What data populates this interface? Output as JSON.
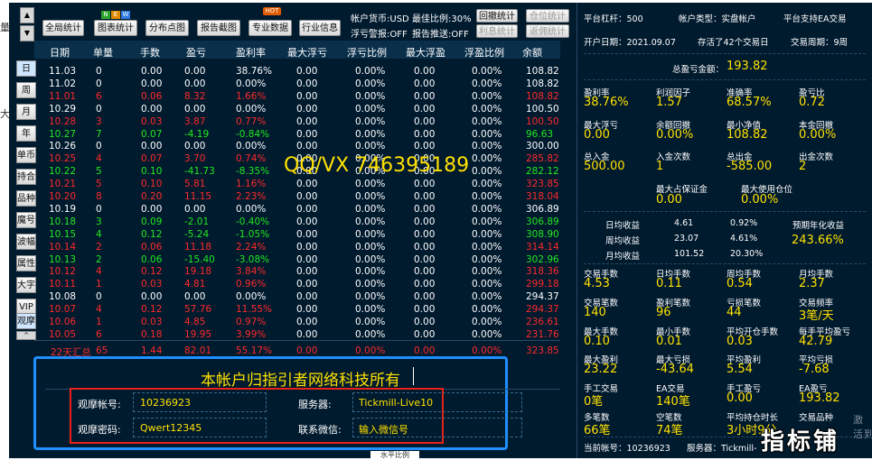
{
  "toolbar": {
    "buttons": [
      "全局统计",
      "图表统计",
      "分布点图",
      "报告截图",
      "专业数据",
      "行业信息"
    ],
    "hot_badge": "HOT",
    "mini_badges": [
      "N",
      "E",
      "W"
    ],
    "info": {
      "currency": "帐户货币:USD",
      "max_ratio": "最佳比例:30%",
      "stop_warning": "浮亏警报:OFF",
      "report_push": "报告推送:OFF"
    },
    "right_buttons": [
      "回撤统计",
      "仓位统计",
      "利息统计",
      "返佣统计"
    ]
  },
  "side_nav": [
    "日",
    "周",
    "月",
    "年",
    "单币",
    "持合",
    "品种",
    "魔号",
    "波幅",
    "属性",
    "大字",
    "VIP",
    "观摩"
  ],
  "table": {
    "headers": [
      "日期",
      "单量",
      "手数",
      "盈亏",
      "盈利率",
      "最大浮亏",
      "浮亏比例",
      "最大浮盈",
      "浮盈比例",
      "余额"
    ],
    "rows": [
      [
        "11.03",
        "0",
        "0.00",
        "0.00",
        "38.76%",
        "0.00",
        "0.00%",
        "0.00",
        "0.00%",
        "108.82",
        "w"
      ],
      [
        "11.02",
        "0",
        "0.00",
        "0.00",
        "0.00%",
        "0.00",
        "0.00%",
        "0.00",
        "0.00%",
        "108.82",
        "w"
      ],
      [
        "11.01",
        "6",
        "0.06",
        "8.32",
        "1.66%",
        "0.00",
        "0.00%",
        "0.00",
        "0.00%",
        "108.82",
        "r"
      ],
      [
        "10.29",
        "0",
        "0.00",
        "0.00",
        "0.00%",
        "0.00",
        "0.00%",
        "0.00",
        "0.00%",
        "100.50",
        "w"
      ],
      [
        "10.28",
        "3",
        "0.03",
        "3.87",
        "0.77%",
        "0.00",
        "0.00%",
        "0.00",
        "0.00%",
        "100.50",
        "r"
      ],
      [
        "10.27",
        "7",
        "0.07",
        "-4.19",
        "-0.84%",
        "0.00",
        "0.00%",
        "0.00",
        "0.00%",
        "96.63",
        "g"
      ],
      [
        "10.26",
        "0",
        "0.00",
        "0.00",
        "0.00%",
        "0.00",
        "0.00%",
        "0.00",
        "0.00%",
        "300.00",
        "w"
      ],
      [
        "10.25",
        "4",
        "0.07",
        "3.70",
        "0.74%",
        "0.00",
        "0.00%",
        "0.00",
        "0.00%",
        "285.82",
        "r"
      ],
      [
        "10.22",
        "5",
        "0.10",
        "-41.73",
        "-8.35%",
        "0.00",
        "0.00%",
        "0.00",
        "0.00%",
        "282.12",
        "g"
      ],
      [
        "10.21",
        "5",
        "0.10",
        "5.81",
        "1.16%",
        "0.00",
        "0.00%",
        "0.00",
        "0.00%",
        "323.85",
        "r"
      ],
      [
        "10.20",
        "8",
        "0.20",
        "11.15",
        "2.23%",
        "0.00",
        "0.00%",
        "0.00",
        "0.00%",
        "318.04",
        "r"
      ],
      [
        "10.19",
        "0",
        "0.00",
        "0.00",
        "0.00%",
        "0.00",
        "0.00%",
        "0.00",
        "0.00%",
        "306.89",
        "w"
      ],
      [
        "10.18",
        "3",
        "0.09",
        "-2.01",
        "-0.40%",
        "0.00",
        "0.00%",
        "0.00",
        "0.00%",
        "306.89",
        "g"
      ],
      [
        "10.15",
        "4",
        "0.12",
        "-5.24",
        "-1.05%",
        "0.00",
        "0.00%",
        "0.00",
        "0.00%",
        "308.90",
        "g"
      ],
      [
        "10.14",
        "2",
        "0.06",
        "11.18",
        "2.24%",
        "0.00",
        "0.00%",
        "0.00",
        "0.00%",
        "314.14",
        "r"
      ],
      [
        "10.13",
        "2",
        "0.06",
        "-15.40",
        "-3.08%",
        "0.00",
        "0.00%",
        "0.00",
        "0.00%",
        "302.96",
        "g"
      ],
      [
        "10.12",
        "4",
        "0.12",
        "19.18",
        "3.84%",
        "0.00",
        "0.00%",
        "0.00",
        "0.00%",
        "318.36",
        "r"
      ],
      [
        "10.11",
        "1",
        "0.03",
        "4.81",
        "0.96%",
        "0.00",
        "0.00%",
        "0.00",
        "0.00%",
        "299.18",
        "r"
      ],
      [
        "10.08",
        "0",
        "0.00",
        "0.00",
        "0.00%",
        "0.00",
        "0.00%",
        "0.00",
        "0.00%",
        "294.37",
        "w"
      ],
      [
        "10.07",
        "4",
        "0.12",
        "57.76",
        "11.55%",
        "0.00",
        "0.00%",
        "0.00",
        "0.00%",
        "294.37",
        "r"
      ],
      [
        "10.06",
        "1",
        "0.03",
        "4.85",
        "0.97%",
        "0.00",
        "0.00%",
        "0.00",
        "0.00%",
        "236.61",
        "r"
      ],
      [
        "10.05",
        "6",
        "0.18",
        "19.95",
        "3.99%",
        "0.00",
        "0.00%",
        "0.00",
        "0.00%",
        "231.76",
        "r"
      ]
    ],
    "total_row": [
      "22天汇总",
      "65",
      "1.44",
      "82.01",
      "55.17%",
      "0.00",
      "0.00%",
      "0.00",
      "0.00%",
      "323.85"
    ]
  },
  "watermark": "QQ/VX 746395189",
  "ownership": {
    "title": "本帐户归指引者网络科技所有",
    "account_label": "观摩帐号:",
    "account_value": "10236923",
    "server_label": "服务器:",
    "server_value": "Tickmill-Live10",
    "password_label": "观摩密码:",
    "password_value": "Qwert12345",
    "wechat_label": "联系微信:",
    "wechat_value": "输入微信号"
  },
  "bottom_tab": "水平比例",
  "right_panel": {
    "top": {
      "leverage": "平台杠杆：500",
      "account_type": "帐户类型：实盘帐户",
      "ea_support": "平台支持EA交易",
      "open_date": "开户日期：2021.09.07",
      "survived": "存活了42个交易日",
      "cycle": "交易周期：9周"
    },
    "total_profit_label": "总盈亏金额：",
    "total_profit_value": "193.82",
    "grid1": [
      {
        "label": "盈利率",
        "value": "38.76%"
      },
      {
        "label": "利润因子",
        "value": "1.57"
      },
      {
        "label": "准确率",
        "value": "68.57%"
      },
      {
        "label": "盈亏比",
        "value": "0.72"
      },
      {
        "label": "最大浮亏",
        "value": "0.00"
      },
      {
        "label": "余额回撤",
        "value": "0.00%"
      },
      {
        "label": "最小净值",
        "value": "108.82"
      },
      {
        "label": "本金回撤",
        "value": "0.00%"
      },
      {
        "label": "总入金",
        "value": "500.00"
      },
      {
        "label": "入金次数",
        "value": "1"
      },
      {
        "label": "总出金",
        "value": "-585.00"
      },
      {
        "label": "出金次数",
        "value": "2"
      }
    ],
    "occupy": [
      {
        "label": "最大占保证金",
        "value": "0.00"
      },
      {
        "label": "最大使用仓位",
        "value": "0.00%"
      }
    ],
    "gains": [
      {
        "label": "日均收益",
        "amount": "4.61",
        "pct": "0.92%"
      },
      {
        "label": "周均收益",
        "amount": "23.07",
        "pct": "4.61%"
      },
      {
        "label": "月均收益",
        "amount": "101.52",
        "pct": "20.30%"
      }
    ],
    "annual_label": "预期年化收益",
    "annual_value": "243.66%",
    "grid2": [
      {
        "label": "交易手数",
        "value": "4.53"
      },
      {
        "label": "日均手数",
        "value": "0.11"
      },
      {
        "label": "周均手数",
        "value": "0.54"
      },
      {
        "label": "月均手数",
        "value": "2.37"
      },
      {
        "label": "交易笔数",
        "value": "140"
      },
      {
        "label": "盈利笔数",
        "value": "96"
      },
      {
        "label": "亏损笔数",
        "value": "44"
      },
      {
        "label": "交易频率",
        "value": "3笔/天"
      },
      {
        "label": "最大手数",
        "value": "0.10"
      },
      {
        "label": "最小手数",
        "value": "0.01"
      },
      {
        "label": "平均开仓手数",
        "value": "0.03"
      },
      {
        "label": "每手平均盈亏",
        "value": "42.79"
      },
      {
        "label": "最大盈利",
        "value": "23.22"
      },
      {
        "label": "最大亏损",
        "value": "-43.64"
      },
      {
        "label": "平均盈利",
        "value": "5.54"
      },
      {
        "label": "平均亏损",
        "value": "-7.68"
      },
      {
        "label": "手工交易",
        "value": "0笔"
      },
      {
        "label": "EA交易",
        "value": "140笔"
      },
      {
        "label": "手工盈亏",
        "value": "0.00"
      },
      {
        "label": "EA盈亏",
        "value": "193.82"
      },
      {
        "label": "多笔数",
        "value": "66笔"
      },
      {
        "label": "空笔数",
        "value": "74笔"
      },
      {
        "label": "平均持仓时长",
        "value": "3小时9分"
      },
      {
        "label": "交易品种",
        "value": ""
      }
    ],
    "footer": {
      "account": "当前帐号：10236923",
      "server": "服务器：Tickmill-"
    },
    "corner_text": "指标铺",
    "edge_text_1": "激活",
    "edge_text_2": "到"
  },
  "left_edge_chars": [
    "量",
    "大"
  ]
}
